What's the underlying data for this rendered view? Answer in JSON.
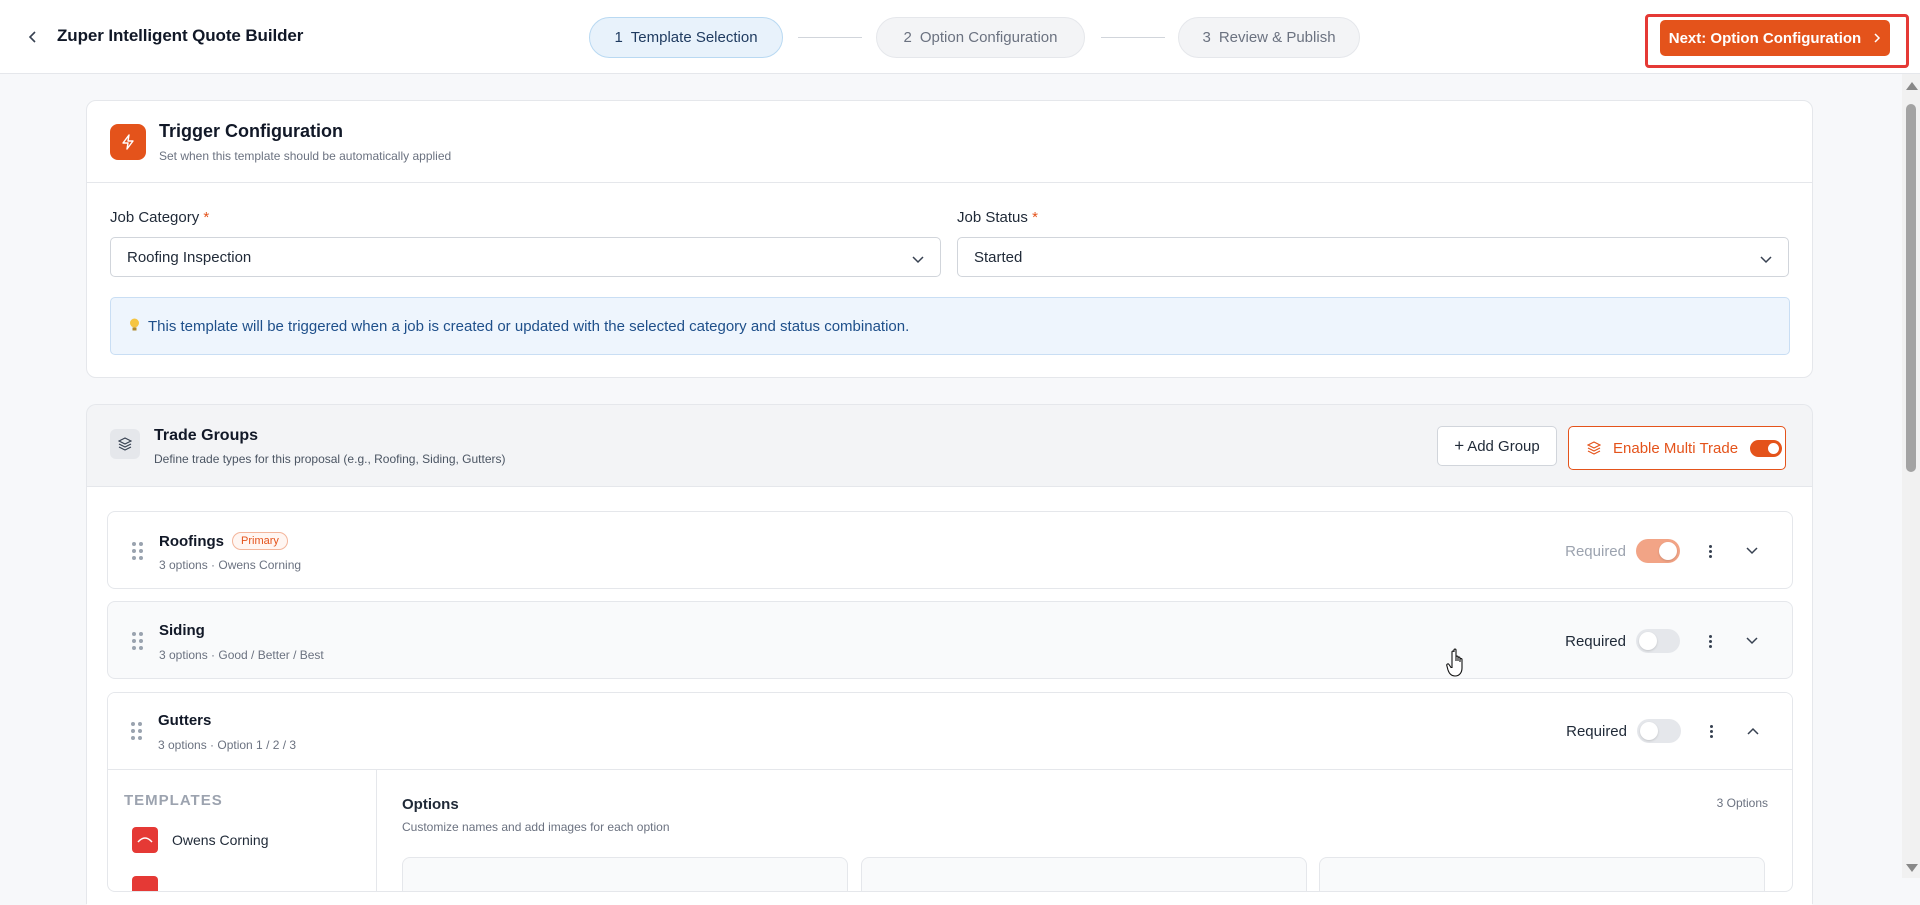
{
  "header": {
    "title": "Zuper Intelligent Quote Builder",
    "steps": [
      {
        "num": "1",
        "label": "Template Selection",
        "active": true
      },
      {
        "num": "2",
        "label": "Option Configuration",
        "active": false
      },
      {
        "num": "3",
        "label": "Review & Publish",
        "active": false
      }
    ],
    "next_label": "Next: Option Configuration"
  },
  "trigger": {
    "title": "Trigger Configuration",
    "subtitle": "Set when this template should be automatically applied",
    "job_category_label": "Job Category",
    "job_category_value": "Roofing Inspection",
    "job_status_label": "Job Status",
    "job_status_value": "Started",
    "required_mark": "*",
    "info_text": "This template will be triggered when a job is created or updated with the selected category and status combination."
  },
  "trade_groups": {
    "title": "Trade Groups",
    "subtitle": "Define trade types for this proposal (e.g., Roofing, Siding, Gutters)",
    "add_group_label": "Add Group",
    "multi_trade_label": "Enable Multi Trade",
    "multi_trade_enabled": true,
    "required_label": "Required",
    "rows": [
      {
        "name": "Roofings",
        "badge": "Primary",
        "sub": "3 options · Owens Corning",
        "required": true,
        "expanded": false
      },
      {
        "name": "Siding",
        "badge": "",
        "sub": "3 options · Good / Better / Best",
        "required": false,
        "expanded": false
      },
      {
        "name": "Gutters",
        "badge": "",
        "sub": "3 options · Option 1 / 2 / 3",
        "required": false,
        "expanded": true
      }
    ],
    "templates_heading": "TEMPLATES",
    "template_item": "Owens Corning",
    "options_title": "Options",
    "options_sub": "Customize names and add images for each option",
    "options_count": "3 Options"
  },
  "colors": {
    "accent": "#e4531b",
    "highlight_outline": "#e53935",
    "info_bg": "#eef5fd",
    "active_step_bg": "#e8f2fb"
  }
}
